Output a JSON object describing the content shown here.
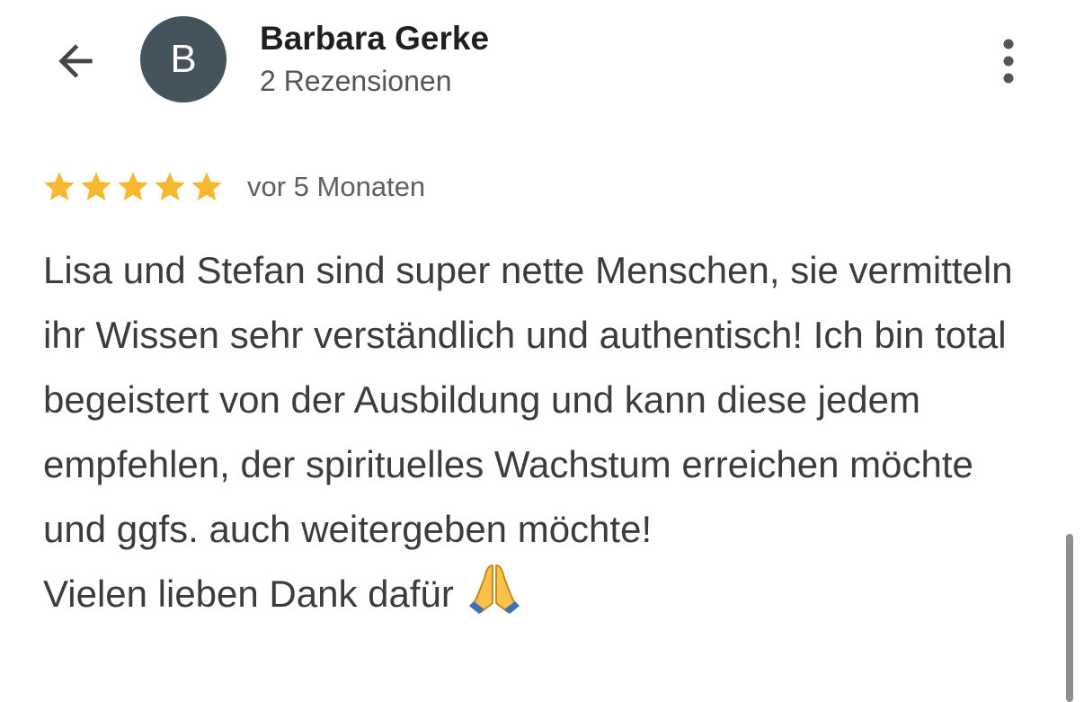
{
  "header": {
    "back_icon": "arrow-left-icon",
    "avatar_letter": "B",
    "avatar_color": "#45535c",
    "author_name": "Barbara Gerke",
    "review_count": "2 Rezensionen",
    "more_icon": "more-vertical-icon"
  },
  "review": {
    "rating": 5,
    "rating_max": 5,
    "star_color": "#f5b82e",
    "date": "vor 5 Monaten",
    "text_paragraph_1": "Lisa und Stefan sind super nette Menschen, sie vermitteln ihr Wissen sehr verständlich und authentisch! Ich bin total begeistert von der Ausbildung und kann diese jedem empfehlen, der spirituelles Wachstum erreichen möchte und ggfs. auch weitergeben möchte!",
    "text_paragraph_2": "Vielen lieben Dank dafür",
    "emoji_icon": "folded-hands-emoji"
  }
}
